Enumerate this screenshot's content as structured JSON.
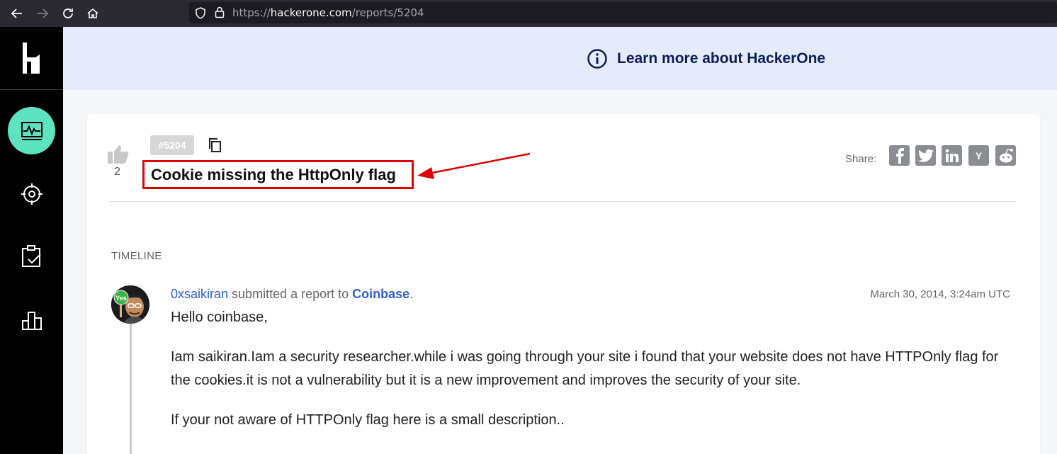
{
  "browser": {
    "url_scheme": "https://",
    "url_domain": "hackerone.com",
    "url_path": "/reports/5204"
  },
  "banner": {
    "link_text": "Learn more about HackerOne"
  },
  "report": {
    "id": "#5204",
    "title": "Cookie missing the HttpOnly flag",
    "votes": "2"
  },
  "share": {
    "label": "Share:",
    "networks": [
      "facebook",
      "twitter",
      "linkedin",
      "ycombinator",
      "reddit"
    ],
    "y_letter": "Y"
  },
  "timeline": {
    "label": "TIMELINE",
    "event": {
      "user": "0xsaikiran",
      "action": " submitted a report to ",
      "org": "Coinbase",
      "period": ".",
      "date": "March 30, 2014, 3:24am UTC",
      "avatar_sign": "Yes",
      "paragraphs": [
        "Hello coinbase,",
        "Iam saikiran.Iam a security researcher.while i was going through your site i found that your website does not have HTTPOnly flag for the cookies.it is not a vulnerability but it is a new improvement and improves the security of your site.",
        "If your not aware of HTTPOnly flag here is a small description.."
      ]
    }
  },
  "colors": {
    "accent": "#5ee3c0",
    "link": "#2d5fd8",
    "annotation": "#e00000",
    "banner_bg": "#e5ebfb"
  }
}
